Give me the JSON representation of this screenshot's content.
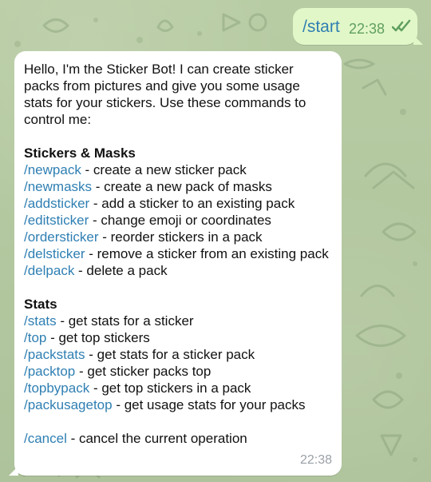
{
  "outgoing": {
    "text": "/start",
    "time": "22:38"
  },
  "incoming": {
    "intro": "Hello, I'm the Sticker Bot! I can create sticker packs from pictures and give you some usage stats for your stickers. Use these commands to control me:",
    "sections": [
      {
        "title": "Stickers & Masks",
        "commands": [
          {
            "cmd": "/newpack",
            "desc": " - create a new sticker pack"
          },
          {
            "cmd": "/newmasks",
            "desc": " - create a new pack of masks"
          },
          {
            "cmd": "/addsticker",
            "desc": " - add a sticker to an existing pack"
          },
          {
            "cmd": "/editsticker",
            "desc": " - change emoji or coordinates"
          },
          {
            "cmd": "/ordersticker",
            "desc": " - reorder stickers in a pack"
          },
          {
            "cmd": "/delsticker",
            "desc": " - remove a sticker from an existing pack"
          },
          {
            "cmd": "/delpack",
            "desc": " - delete a pack"
          }
        ]
      },
      {
        "title": "Stats",
        "commands": [
          {
            "cmd": "/stats",
            "desc": " - get stats for a sticker"
          },
          {
            "cmd": "/top",
            "desc": " - get top stickers"
          },
          {
            "cmd": "/packstats",
            "desc": " - get stats for a sticker pack"
          },
          {
            "cmd": "/packtop",
            "desc": " - get sticker packs top"
          },
          {
            "cmd": "/topbypack",
            "desc": " - get top stickers in a pack"
          },
          {
            "cmd": "/packusagetop",
            "desc": " - get usage stats for your packs"
          }
        ]
      }
    ],
    "cancel": {
      "cmd": "/cancel",
      "desc": " - cancel the current operation"
    },
    "time": "22:38"
  },
  "icons": {
    "read_receipt": "double-check-icon"
  },
  "colors": {
    "wallpaper": "#b6c9a2",
    "outgoing_bubble": "#e2f7c8",
    "incoming_bubble": "#ffffff",
    "link": "#2f7fb3",
    "check": "#5f9f5f",
    "time_gray": "#9aa1a7"
  }
}
